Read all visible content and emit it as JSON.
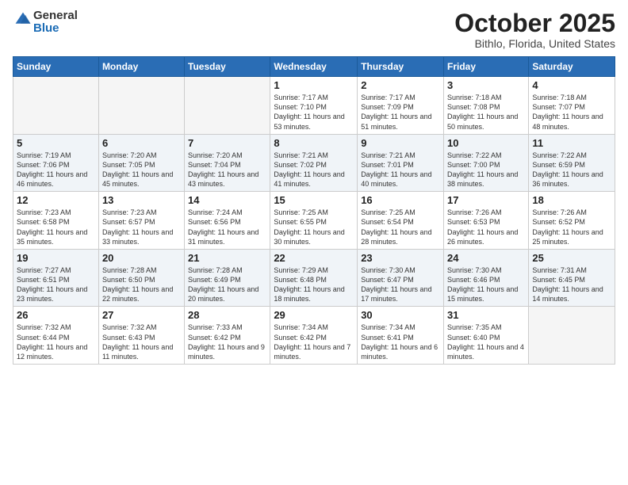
{
  "header": {
    "logo_general": "General",
    "logo_blue": "Blue",
    "month_title": "October 2025",
    "location": "Bithlo, Florida, United States"
  },
  "weekdays": [
    "Sunday",
    "Monday",
    "Tuesday",
    "Wednesday",
    "Thursday",
    "Friday",
    "Saturday"
  ],
  "weeks": [
    [
      {
        "day": "",
        "content": ""
      },
      {
        "day": "",
        "content": ""
      },
      {
        "day": "",
        "content": ""
      },
      {
        "day": "1",
        "content": "Sunrise: 7:17 AM\nSunset: 7:10 PM\nDaylight: 11 hours\nand 53 minutes."
      },
      {
        "day": "2",
        "content": "Sunrise: 7:17 AM\nSunset: 7:09 PM\nDaylight: 11 hours\nand 51 minutes."
      },
      {
        "day": "3",
        "content": "Sunrise: 7:18 AM\nSunset: 7:08 PM\nDaylight: 11 hours\nand 50 minutes."
      },
      {
        "day": "4",
        "content": "Sunrise: 7:18 AM\nSunset: 7:07 PM\nDaylight: 11 hours\nand 48 minutes."
      }
    ],
    [
      {
        "day": "5",
        "content": "Sunrise: 7:19 AM\nSunset: 7:06 PM\nDaylight: 11 hours\nand 46 minutes."
      },
      {
        "day": "6",
        "content": "Sunrise: 7:20 AM\nSunset: 7:05 PM\nDaylight: 11 hours\nand 45 minutes."
      },
      {
        "day": "7",
        "content": "Sunrise: 7:20 AM\nSunset: 7:04 PM\nDaylight: 11 hours\nand 43 minutes."
      },
      {
        "day": "8",
        "content": "Sunrise: 7:21 AM\nSunset: 7:02 PM\nDaylight: 11 hours\nand 41 minutes."
      },
      {
        "day": "9",
        "content": "Sunrise: 7:21 AM\nSunset: 7:01 PM\nDaylight: 11 hours\nand 40 minutes."
      },
      {
        "day": "10",
        "content": "Sunrise: 7:22 AM\nSunset: 7:00 PM\nDaylight: 11 hours\nand 38 minutes."
      },
      {
        "day": "11",
        "content": "Sunrise: 7:22 AM\nSunset: 6:59 PM\nDaylight: 11 hours\nand 36 minutes."
      }
    ],
    [
      {
        "day": "12",
        "content": "Sunrise: 7:23 AM\nSunset: 6:58 PM\nDaylight: 11 hours\nand 35 minutes."
      },
      {
        "day": "13",
        "content": "Sunrise: 7:23 AM\nSunset: 6:57 PM\nDaylight: 11 hours\nand 33 minutes."
      },
      {
        "day": "14",
        "content": "Sunrise: 7:24 AM\nSunset: 6:56 PM\nDaylight: 11 hours\nand 31 minutes."
      },
      {
        "day": "15",
        "content": "Sunrise: 7:25 AM\nSunset: 6:55 PM\nDaylight: 11 hours\nand 30 minutes."
      },
      {
        "day": "16",
        "content": "Sunrise: 7:25 AM\nSunset: 6:54 PM\nDaylight: 11 hours\nand 28 minutes."
      },
      {
        "day": "17",
        "content": "Sunrise: 7:26 AM\nSunset: 6:53 PM\nDaylight: 11 hours\nand 26 minutes."
      },
      {
        "day": "18",
        "content": "Sunrise: 7:26 AM\nSunset: 6:52 PM\nDaylight: 11 hours\nand 25 minutes."
      }
    ],
    [
      {
        "day": "19",
        "content": "Sunrise: 7:27 AM\nSunset: 6:51 PM\nDaylight: 11 hours\nand 23 minutes."
      },
      {
        "day": "20",
        "content": "Sunrise: 7:28 AM\nSunset: 6:50 PM\nDaylight: 11 hours\nand 22 minutes."
      },
      {
        "day": "21",
        "content": "Sunrise: 7:28 AM\nSunset: 6:49 PM\nDaylight: 11 hours\nand 20 minutes."
      },
      {
        "day": "22",
        "content": "Sunrise: 7:29 AM\nSunset: 6:48 PM\nDaylight: 11 hours\nand 18 minutes."
      },
      {
        "day": "23",
        "content": "Sunrise: 7:30 AM\nSunset: 6:47 PM\nDaylight: 11 hours\nand 17 minutes."
      },
      {
        "day": "24",
        "content": "Sunrise: 7:30 AM\nSunset: 6:46 PM\nDaylight: 11 hours\nand 15 minutes."
      },
      {
        "day": "25",
        "content": "Sunrise: 7:31 AM\nSunset: 6:45 PM\nDaylight: 11 hours\nand 14 minutes."
      }
    ],
    [
      {
        "day": "26",
        "content": "Sunrise: 7:32 AM\nSunset: 6:44 PM\nDaylight: 11 hours\nand 12 minutes."
      },
      {
        "day": "27",
        "content": "Sunrise: 7:32 AM\nSunset: 6:43 PM\nDaylight: 11 hours\nand 11 minutes."
      },
      {
        "day": "28",
        "content": "Sunrise: 7:33 AM\nSunset: 6:42 PM\nDaylight: 11 hours\nand 9 minutes."
      },
      {
        "day": "29",
        "content": "Sunrise: 7:34 AM\nSunset: 6:42 PM\nDaylight: 11 hours\nand 7 minutes."
      },
      {
        "day": "30",
        "content": "Sunrise: 7:34 AM\nSunset: 6:41 PM\nDaylight: 11 hours\nand 6 minutes."
      },
      {
        "day": "31",
        "content": "Sunrise: 7:35 AM\nSunset: 6:40 PM\nDaylight: 11 hours\nand 4 minutes."
      },
      {
        "day": "",
        "content": ""
      }
    ]
  ]
}
